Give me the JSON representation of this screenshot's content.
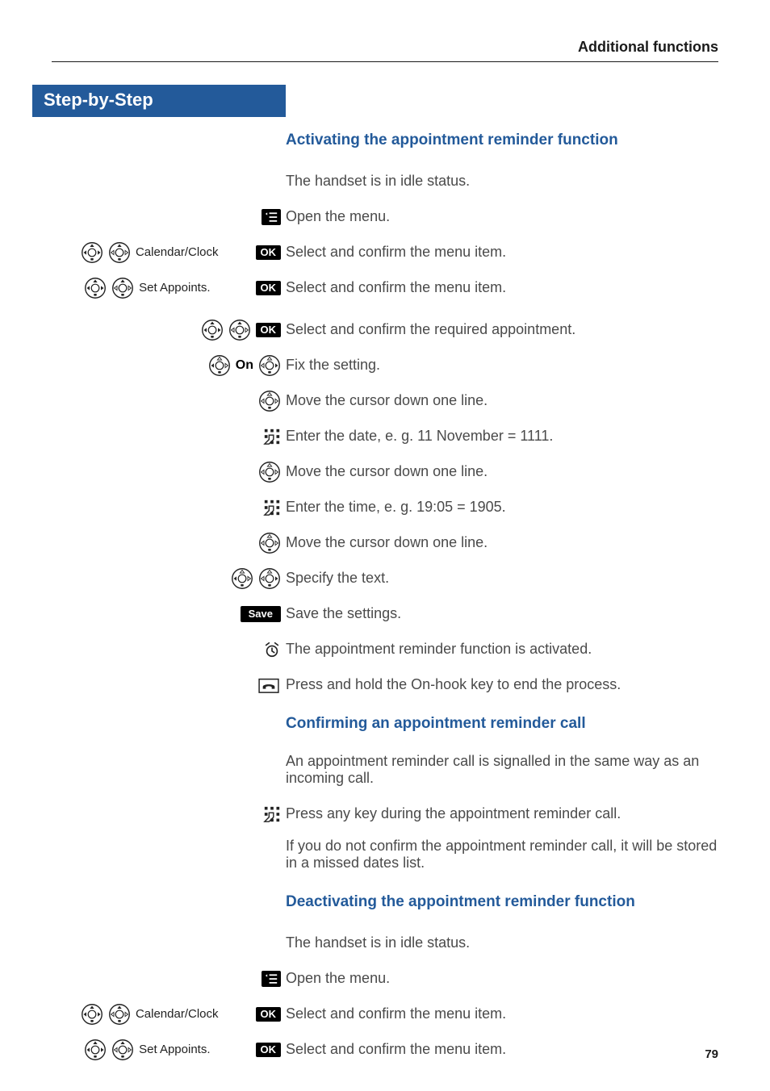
{
  "header": {
    "title": "Additional functions"
  },
  "step_banner": "Step-by-Step",
  "labels": {
    "ok": "OK",
    "save": "Save",
    "on": "On"
  },
  "menu_items": {
    "calendar_clock": "Calendar/Clock",
    "set_appoints": "Set Appoints."
  },
  "sections": {
    "activating": {
      "heading": "Activating the appointment reminder function",
      "idle": "The handset is in idle status.",
      "open_menu": "Open the menu.",
      "select_confirm": "Select and confirm the menu item.",
      "select_appointment": "Select and confirm the required appointment.",
      "fix_setting": "Fix the setting.",
      "cursor_down": "Move the cursor down one line.",
      "enter_date": "Enter the date, e. g. 11 November = 1111.",
      "enter_time": "Enter the time, e. g. 19:05 = 1905.",
      "specify_text": "Specify the text.",
      "save_settings": "Save the settings.",
      "activated": "The appointment reminder function is activated.",
      "end_process": "Press and hold the On-hook key to end the process."
    },
    "confirming": {
      "heading": "Confirming an appointment reminder call",
      "signalled": "An appointment reminder call is signalled in the same way as an incoming call.",
      "press_any_key": "Press any key during the appointment reminder call.",
      "missed_dates": "If you do not confirm the appointment reminder call, it will be stored in a missed dates list."
    },
    "deactivating": {
      "heading": "Deactivating the appointment reminder function",
      "idle": "The handset is in idle status.",
      "open_menu": "Open the menu.",
      "select_confirm": "Select and confirm the menu item."
    }
  },
  "page_number": "79"
}
